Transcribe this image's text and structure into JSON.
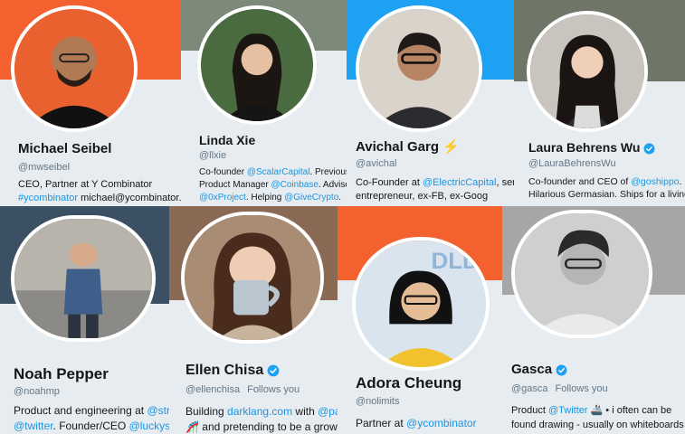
{
  "profiles": {
    "michael": {
      "name": "Michael Seibel",
      "handle": "@mwseibel",
      "bio1": "CEO, Partner at Y Combinator",
      "bio2_link": "#ycombinator",
      "bio2_text": " michael@ycombinator.com",
      "banner_color": "#f3622e"
    },
    "linda": {
      "name": "Linda Xie",
      "handle": "@llxie",
      "bio1_a": "Co-founder ",
      "bio1_link": "@ScalarCapital",
      "bio1_b": ". Previously",
      "bio2_a": "Product Manager ",
      "bio2_link": "@Coinbase",
      "bio2_b": ". Advisor",
      "bio3_link1": "@0xProject",
      "bio3_mid": ". Helping ",
      "bio3_link2": "@GiveCrypto",
      "bio3_end": "."
    },
    "avichal": {
      "name": "Avichal Garg",
      "emoji": "⚡",
      "handle": "@avichal",
      "bio1_a": "Co-Founder at ",
      "bio1_link": "@ElectricCapital",
      "bio1_b": ", serial",
      "bio2": "entrepreneur, ex-FB, ex-Goog",
      "banner_color": "#1da1f2"
    },
    "laura": {
      "name": "Laura Behrens Wu",
      "handle": "@LauraBehrensWu",
      "bio1_a": "Co-founder and CEO of ",
      "bio1_link": "@goshippo",
      "bio1_b": ".",
      "bio2": "Hilarious Germasian. Ships for a living."
    },
    "noah": {
      "name": "Noah Pepper",
      "handle": "@noahmp",
      "bio1_a": "Product and engineering at ",
      "bio1_link": "@stripe",
      "bio1_b": ".",
      "bio2_link1": "@twitter",
      "bio2_mid": ". Founder/CEO ",
      "bio2_link2": "@luckysort"
    },
    "ellen": {
      "name": "Ellen Chisa",
      "handle": "@ellenchisa",
      "follows": "Follows you",
      "bio1_a": "Building ",
      "bio1_link1": "darklang.com",
      "bio1_mid": " with ",
      "bio1_link2": "@paulb",
      "bio2_emoji": "🎢",
      "bio2": " and pretending to be a grownup"
    },
    "adora": {
      "name": "Adora Cheung",
      "handle": "@nolimits",
      "bio1_a": "Partner at ",
      "bio1_link": "@ycombinator",
      "banner_color": "#f3622e",
      "banner_text": "DLD"
    },
    "gasca": {
      "name": "Gasca",
      "handle": "@gasca",
      "follows": "Follows you",
      "bio1_a": "Product ",
      "bio1_link": "@Twitter",
      "bio1_emoji": "🚢",
      "bio1_b": " • i often can be",
      "bio2": "found drawing - usually on whiteboards"
    }
  },
  "colors": {
    "link": "#1b95e0",
    "verified": "#1da1f2",
    "text": "#14171a",
    "muted": "#657786"
  },
  "icons": {
    "verified": "verified-badge-icon"
  }
}
